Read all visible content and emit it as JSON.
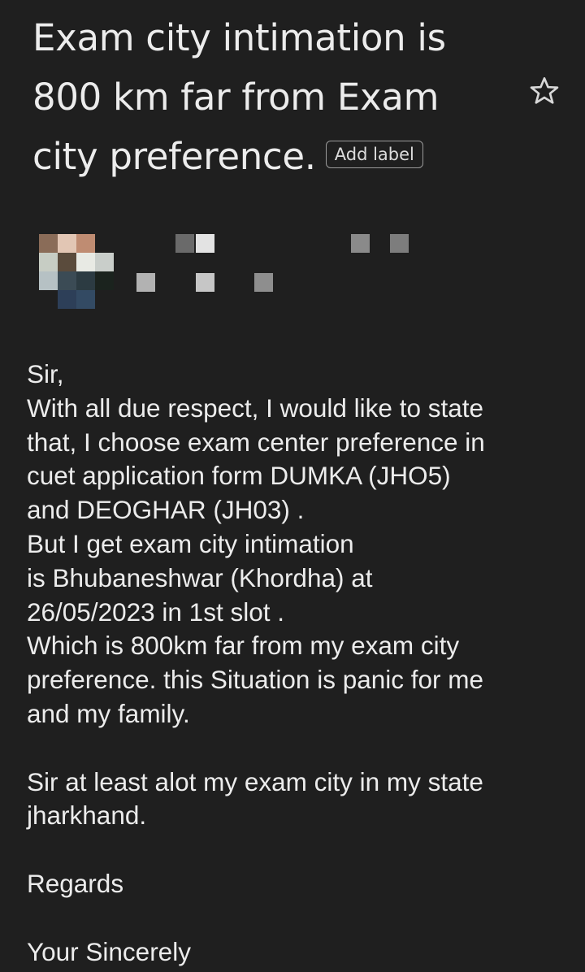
{
  "email": {
    "subject_lines": [
      "Exam city intimation is",
      "800 km far from Exam",
      "city preference."
    ],
    "add_label": "Add label",
    "star_icon": "star-outline-icon",
    "avatar_icon": "pixelated-avatar",
    "sender_name_icon": "pixelated-sender-info",
    "body": {
      "greeting": "Sir,",
      "p1_lines": [
        "With all due respect, I would like to state",
        "that, I choose exam center preference in",
        "cuet application form DUMKA (JHO5)",
        "and DEOGHAR (JH03) .",
        "But I get exam city intimation",
        "is Bhubaneshwar (Khordha) at",
        "26/05/2023 in 1st slot .",
        "Which is 800km far from my exam city",
        "preference. this Situation is panic for me",
        "and my family."
      ],
      "p2_lines": [
        "Sir at least alot my exam city in my state",
        "jharkhand."
      ],
      "regards": "Regards",
      "signoff": "Your Sincerely"
    }
  },
  "colors": {
    "background": "#1f1f1f",
    "text": "#ececec",
    "chip_border": "#9a9a9a"
  }
}
